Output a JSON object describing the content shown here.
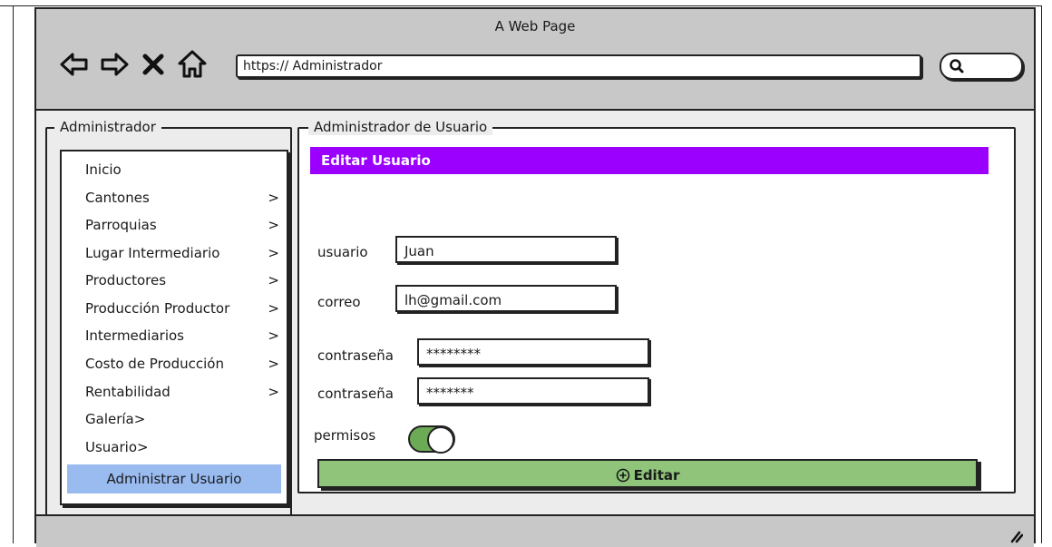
{
  "browser": {
    "window_title": "A Web Page",
    "url": "https:// Administrador",
    "nav_icons": [
      "back-arrow-icon",
      "forward-arrow-icon",
      "close-x-icon",
      "home-icon"
    ],
    "search_icon": "search-icon"
  },
  "sidebar": {
    "legend": "Administrador",
    "items": [
      {
        "label": "Inicio",
        "chevron": ""
      },
      {
        "label": "Cantones",
        "chevron": ">"
      },
      {
        "label": "Parroquias",
        "chevron": ">"
      },
      {
        "label": "Lugar Intermediario",
        "chevron": ">"
      },
      {
        "label": "Productores",
        "chevron": ">"
      },
      {
        "label": "Producción Productor",
        "chevron": ">"
      },
      {
        "label": "Intermediarios",
        "chevron": ">"
      },
      {
        "label": "Costo de Producción",
        "chevron": ">"
      },
      {
        "label": "Rentabilidad",
        "chevron": ">"
      },
      {
        "label": "Galería>",
        "chevron": ""
      },
      {
        "label": "Usuario>",
        "chevron": ""
      }
    ],
    "selected_item": "Administrar Usuario",
    "selected_color": "#99bbf0"
  },
  "main": {
    "legend": "Administrador de Usuario",
    "header": "Editar Usuario",
    "header_color": "#9b00ff",
    "form": {
      "usuario_label": "usuario",
      "usuario_value": "Juan",
      "correo_label": "correo",
      "correo_value": "lh@gmail.com",
      "password_label": "contraseña",
      "password_value": "********",
      "password_confirm_label": "contraseña",
      "password_confirm_value": "*******",
      "permisos_label": "permisos",
      "permisos_on": true
    },
    "submit_label": "Editar",
    "submit_color": "#8fc47a"
  }
}
